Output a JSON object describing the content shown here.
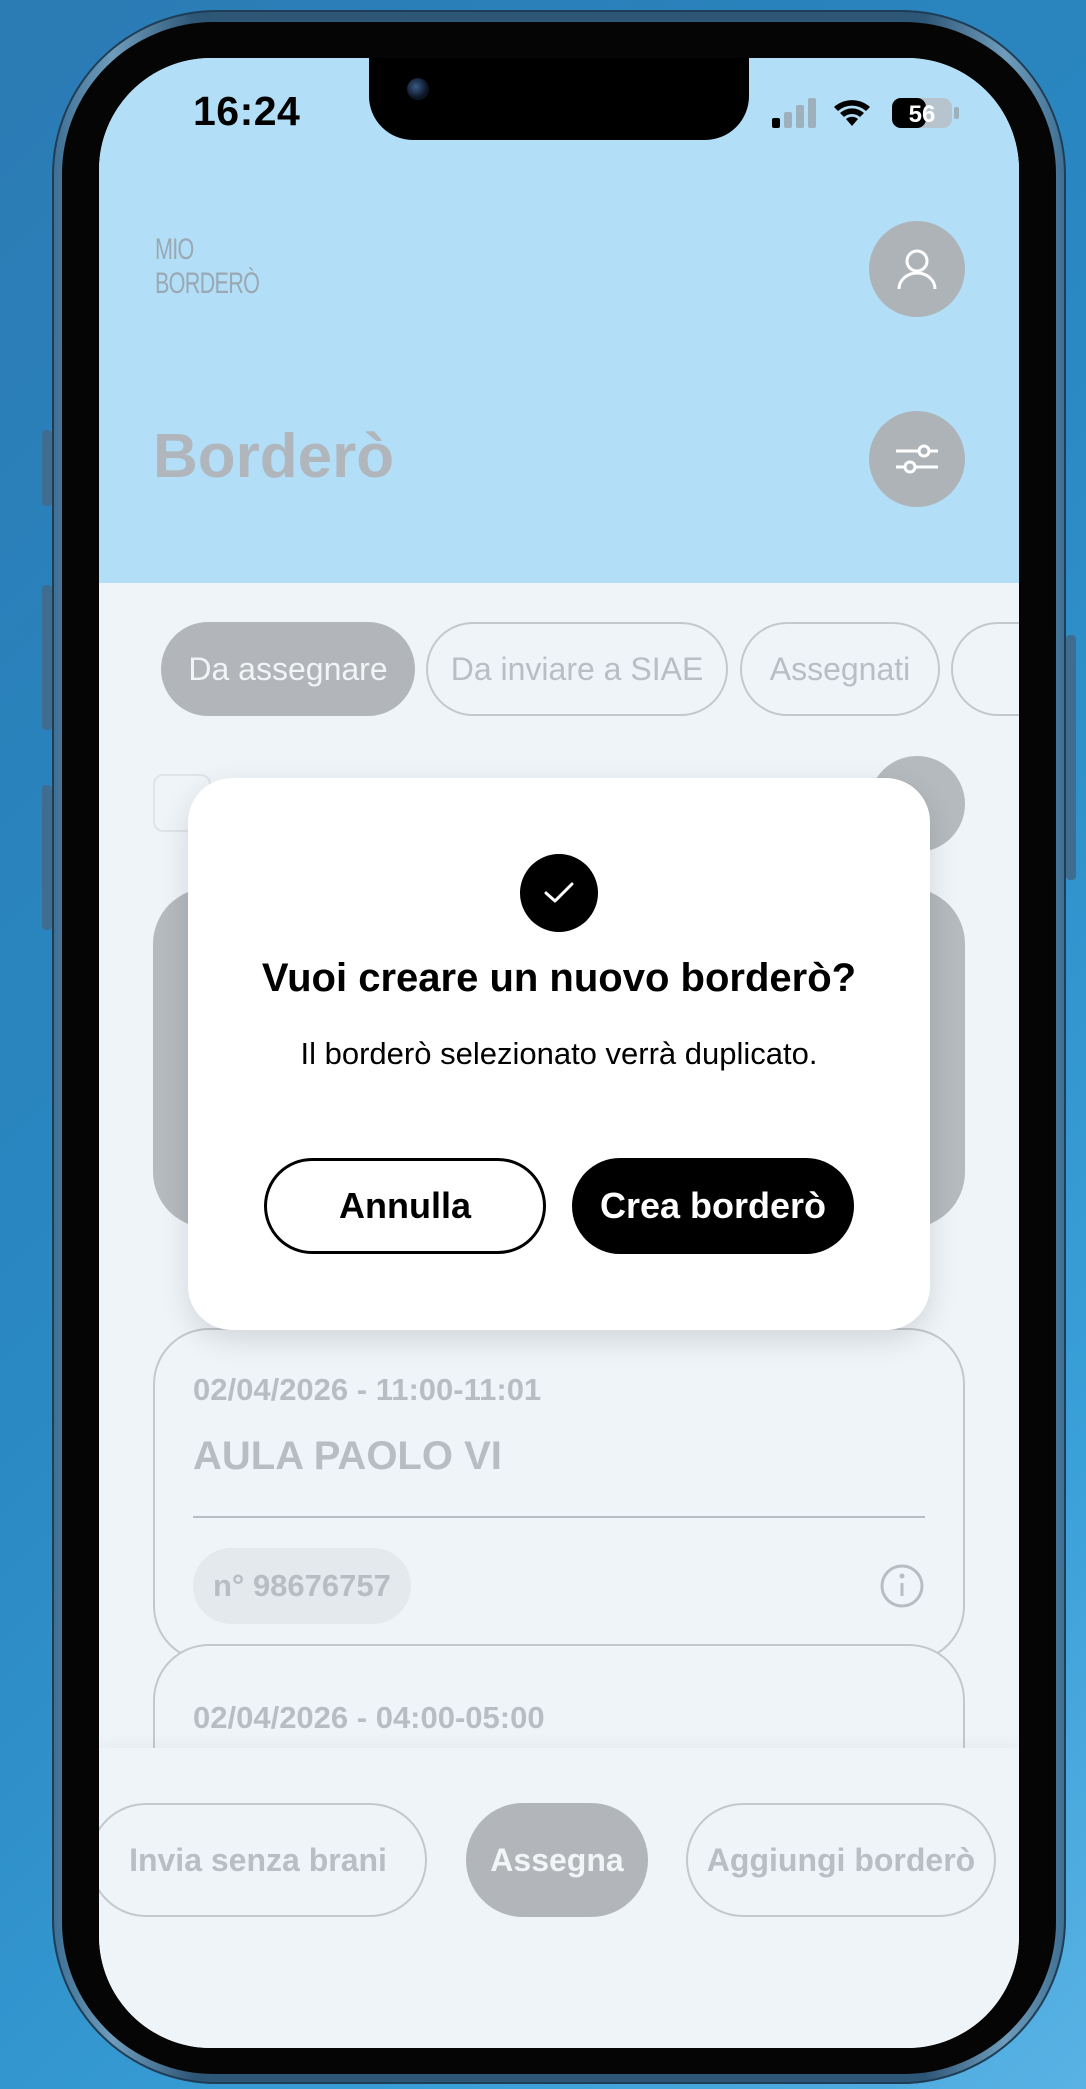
{
  "status_bar": {
    "time": "16:24",
    "battery": "56",
    "icons": [
      "signal-icon",
      "wifi-icon",
      "battery-icon"
    ]
  },
  "header": {
    "logo_line1": "MIO",
    "logo_line2": "BORDERÒ",
    "title": "Borderò",
    "icons": [
      "user-icon",
      "filter-sliders-icon"
    ]
  },
  "tabs": [
    {
      "label": "Da assegnare",
      "active": true
    },
    {
      "label": "Da inviare a SIAE",
      "active": false
    },
    {
      "label": "Assegnati",
      "active": false
    }
  ],
  "cards": [
    {
      "date": "02/04/2026 - 11:00-11:01",
      "place": "AULA PAOLO VI",
      "number": "n° 98676757"
    },
    {
      "date": "02/04/2026 - 04:00-05:00"
    }
  ],
  "bottom_actions": {
    "send_without_tracks": "Invia senza brani",
    "assign": "Assegna",
    "add_bordero": "Aggiungi borderò"
  },
  "modal": {
    "icon": "check-icon",
    "title": "Vuoi creare un nuovo borderò?",
    "message": "Il borderò selezionato verrà duplicato.",
    "cancel_label": "Annulla",
    "confirm_label": "Crea borderò"
  },
  "colors": {
    "header_bg": "#b2dff7",
    "screen_bg": "#eff4f8",
    "modal_primary": "#000000"
  }
}
